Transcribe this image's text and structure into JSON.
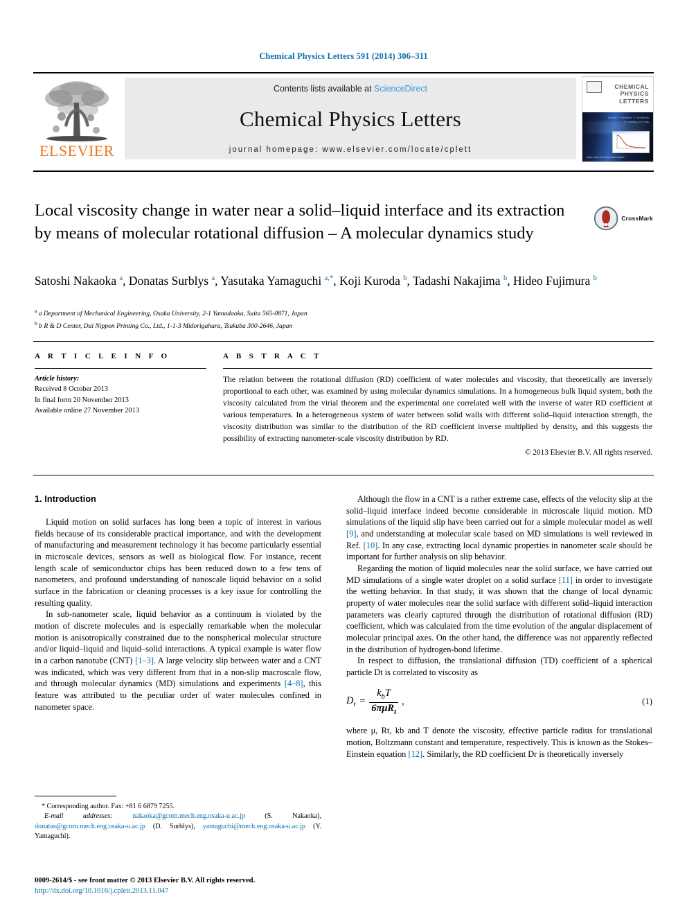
{
  "running_head": "Chemical Physics Letters 591 (2014) 306–311",
  "masthead": {
    "publisher_name": "ELSEVIER",
    "contents_prefix": "Contents lists available at ",
    "contents_link": "ScienceDirect",
    "journal_name": "Chemical Physics Letters",
    "homepage": "journal homepage: www.elsevier.com/locate/cplett",
    "cover": {
      "title_lines": [
        "CHEMICAL",
        "PHYSICS",
        "LETTERS"
      ],
      "url": "www.elsevier.com/locate/cplett",
      "sub_lines": [
        "Editors: D. Neumark, V. Sundström",
        "H. Fielding, D.S. Ray"
      ]
    }
  },
  "article": {
    "title": "Local viscosity change in water near a solid–liquid interface and its extraction by means of molecular rotational diffusion – A molecular dynamics study",
    "crossmark_label": "CrossMark",
    "authors_html": "Satoshi Nakaoka <sup>a</sup>, Donatas Surblys <sup>a</sup>, Yasutaka Yamaguchi <sup>a,*</sup>, Koji Kuroda <sup>b</sup>, Tadashi Nakajima <sup>b</sup>, Hideo Fujimura <sup>b</sup>",
    "affiliations": [
      "a Department of Mechanical Engineering, Osaka University, 2-1 Yamadaoka, Suita 565-0871, Japan",
      "b R & D Center, Dai Nippon Printing Co., Ltd., 1-1-3 Midorigahara, Tsukuba 300-2646, Japan"
    ]
  },
  "article_info": {
    "heading": "A R T I C L E  I N F O",
    "history_label": "Article history:",
    "history": [
      "Received 8 October 2013",
      "In final form 20 November 2013",
      "Available online 27 November 2013"
    ]
  },
  "abstract": {
    "heading": "A B S T R A C T",
    "text": "The relation between the rotational diffusion (RD) coefficient of water molecules and viscosity, that theoretically are inversely proportional to each other, was examined by using molecular dynamics simulations. In a homogeneous bulk liquid system, both the viscosity calculated from the virial theorem and the experimental one correlated well with the inverse of water RD coefficient at various temperatures. In a heterogeneous system of water between solid walls with different solid–liquid interaction strength, the viscosity distribution was similar to the distribution of the RD coefficient inverse multiplied by density, and this suggests the possibility of extracting nanometer-scale viscosity distribution by RD.",
    "copyright": "© 2013 Elsevier B.V. All rights reserved."
  },
  "body": {
    "section_heading": "1. Introduction",
    "left_paragraphs": [
      "Liquid motion on solid surfaces has long been a topic of interest in various fields because of its considerable practical importance, and with the development of manufacturing and measurement technology it has become particularly essential in microscale devices, sensors as well as biological flow. For instance, recent length scale of semiconductor chips has been reduced down to a few tens of nanometers, and profound understanding of nanoscale liquid behavior on a solid surface in the fabrication or cleaning processes is a key issue for controlling the resulting quality."
    ],
    "left_paragraph_2_parts": {
      "a": "In sub-nanometer scale, liquid behavior as a continuum is violated by the motion of discrete molecules and is especially remarkable when the molecular motion is anisotropically constrained due to the nonspherical molecular structure and/or liquid–liquid and liquid–solid interactions. A typical example is water flow in a carbon nanotube (CNT) ",
      "ref1": "[1–3]",
      "b": ". A large velocity slip between water and a CNT was indicated, which was very different from that in a non-slip macroscale flow, and through molecular dynamics (MD) simulations and experiments ",
      "ref2": "[4–8]",
      "c": ", this feature was attributed to the peculiar order of water molecules confined in nanometer space."
    },
    "right_paragraph_1_parts": {
      "a": "Although the flow in a CNT is a rather extreme case, effects of the velocity slip at the solid–liquid interface indeed become considerable in microscale liquid motion. MD simulations of the liquid slip have been carried out for a simple molecular model as well ",
      "ref1": "[9]",
      "b": ", and understanding at molecular scale based on MD simulations is well reviewed in Ref. ",
      "ref2": "[10]",
      "c": ". In any case, extracting local dynamic properties in nanometer scale should be important for further analysis on slip behavior."
    },
    "right_paragraph_2_parts": {
      "a": "Regarding the motion of liquid molecules near the solid surface, we have carried out MD simulations of a single water droplet on a solid surface ",
      "ref1": "[11]",
      "b": " in order to investigate the wetting behavior. In that study, it was shown that the change of local dynamic property of water molecules near the solid surface with different solid–liquid interaction parameters was clearly captured through the distribution of rotational diffusion (RD) coefficient, which was calculated from the time evolution of the angular displacement of molecular principal axes. On the other hand, the difference was not apparently reflected in the distribution of hydrogen-bond lifetime."
    },
    "right_paragraph_3": "In respect to diffusion, the translational diffusion (TD) coefficient of a spherical particle Dt is correlated to viscosity as",
    "equation": {
      "lhs": "D",
      "lhs_sub": "t",
      "equals": "=",
      "numerator": "k",
      "numerator_sub": "b",
      "numerator_tail": "T",
      "denominator": "6πμR",
      "denominator_sub": "t",
      "comma": ",",
      "number": "(1)"
    },
    "right_paragraph_4_parts": {
      "a": "where μ, Rt, kb and T denote the viscosity, effective particle radius for translational motion, Boltzmann constant and temperature, respectively. This is known as the Stokes–Einstein equation ",
      "ref1": "[12]",
      "b": ". Similarly, the RD coefficient Dr is theoretically inversely"
    }
  },
  "footnotes": {
    "corresponding": "* Corresponding author. Fax: +81 6 6879 7255.",
    "email_label": "E-mail addresses:",
    "email_1": "nakaoka@gcom.mech.eng.osaka-u.ac.jp",
    "email_1_who": " (S. Nakaoka), ",
    "email_2": "donatas@gcom.mech.eng.osaka-u.ac.jp",
    "email_2_who": " (D. Surblys), ",
    "email_3": "yamaguchi@mech.eng.osaka-u.ac.jp",
    "email_3_who": " (Y. Yamaguchi)."
  },
  "imprint": {
    "line1": "0009-2614/$ - see front matter © 2013 Elsevier B.V. All rights reserved.",
    "doi": "http://dx.doi.org/10.1016/j.cplett.2013.11.047"
  },
  "colors": {
    "link": "#0b6ea8",
    "elsevier_orange": "#E87722",
    "sciencedirect": "#3a9bd9"
  }
}
